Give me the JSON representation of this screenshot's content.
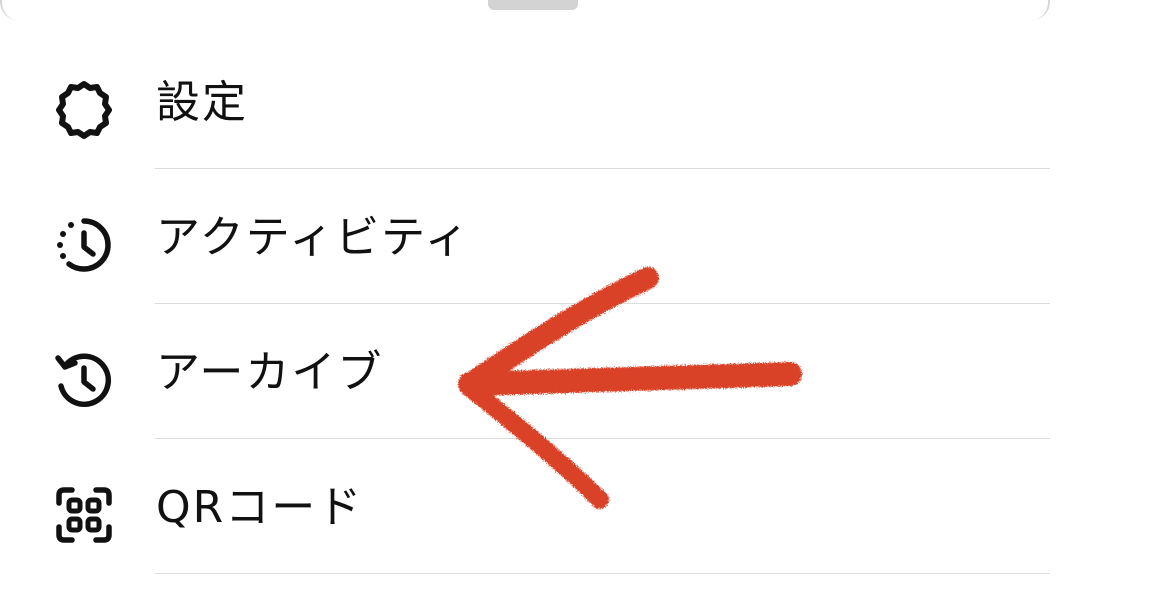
{
  "menu": {
    "items": [
      {
        "label": "設定",
        "icon": "gear-icon"
      },
      {
        "label": "アクティビティ",
        "icon": "activity-clock-icon"
      },
      {
        "label": "アーカイブ",
        "icon": "archive-history-icon"
      },
      {
        "label": "QRコード",
        "icon": "qr-code-icon"
      }
    ]
  },
  "annotation": {
    "type": "hand-drawn-arrow",
    "points_to": "アーカイブ",
    "color": "#d9381e"
  }
}
